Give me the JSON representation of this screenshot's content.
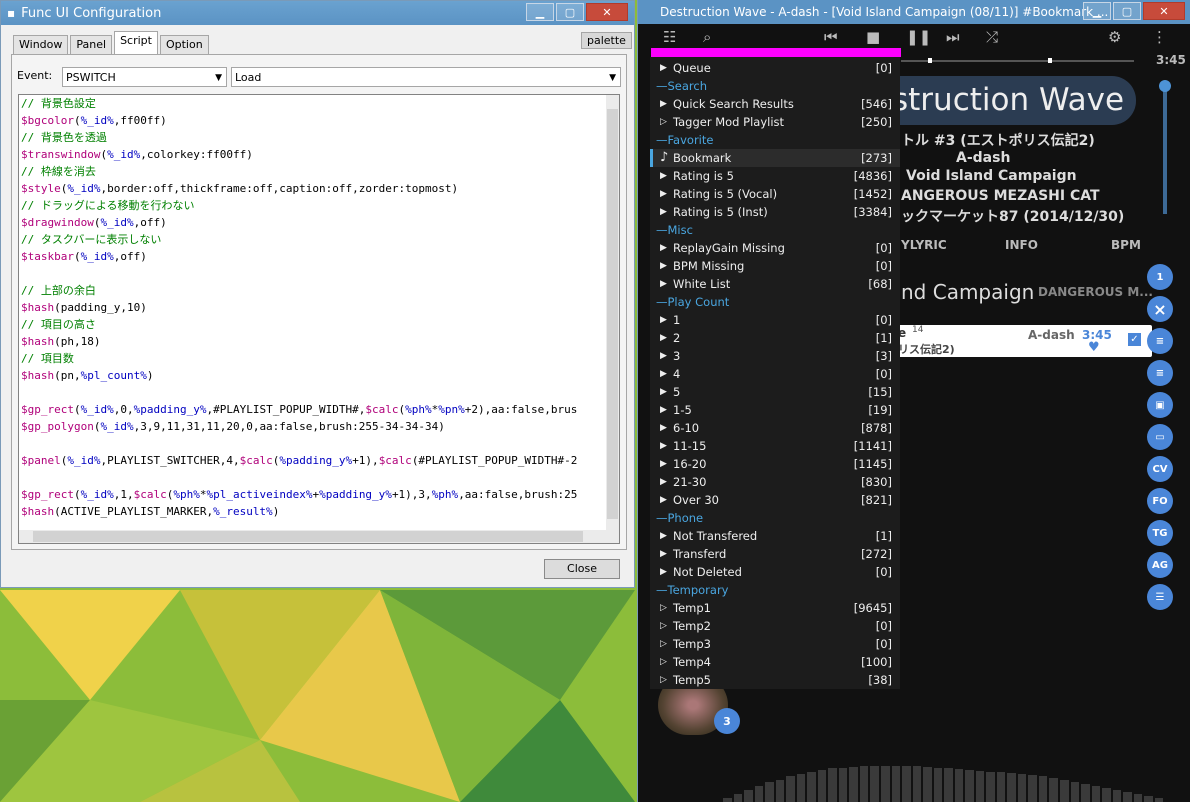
{
  "left_window": {
    "title": "Func UI Configuration",
    "tabs": [
      "Window",
      "Panel",
      "Script",
      "Option"
    ],
    "active_tab": "Script",
    "palette_label": "palette",
    "event_label": "Event:",
    "event_select": "PSWITCH",
    "action_select": "Load",
    "code_lines": [
      "// 背景色設定",
      "$bgcolor(%_id%,ff00ff)",
      "// 背景色を透過",
      "$transwindow(%_id%,colorkey:ff00ff)",
      "// 枠線を消去",
      "$style(%_id%,border:off,thickframe:off,caption:off,zorder:topmost)",
      "// ドラッグによる移動を行わない",
      "$dragwindow(%_id%,off)",
      "// タスクバーに表示しない",
      "$taskbar(%_id%,off)",
      "",
      "// 上部の余白",
      "$hash(padding_y,10)",
      "// 項目の高さ",
      "$hash(ph,18)",
      "// 項目数",
      "$hash(pn,%pl_count%)",
      "",
      "$gp_rect(%_id%,0,%padding_y%,#PLAYLIST_POPUP_WIDTH#,$calc(%ph%*%pn%+2),aa:false,brus",
      "$gp_polygon(%_id%,3,9,11,31,11,20,0,aa:false,brush:255-34-34-34)",
      "",
      "$panel(%_id%,PLAYLIST_SWITCHER,4,$calc(%padding_y%+1),$calc(#PLAYLIST_POPUP_WIDTH#-2",
      "",
      "$gp_rect(%_id%,1,$calc(%ph%*%pl_activeindex%+%padding_y%+1),3,%ph%,aa:false,brush:25",
      "$hash(ACTIVE_PLAYLIST_MARKER,%_result%)"
    ],
    "close_label": "Close"
  },
  "right_window": {
    "title": "Destruction Wave - A-dash - [Void Island Campaign (08/11)]  #Bookmark ...",
    "time": "3:45",
    "track_title": "struction Wave",
    "info_lines": [
      "トル #3 (エストポリス伝記2)",
      "A-dash",
      "Void Island Campaign",
      "ANGEROUS MEZASHI CAT",
      "ックマーケット87 (2014/12/30)"
    ],
    "tab_labels": [
      "YLYRIC",
      "INFO",
      "BPM"
    ],
    "album_line": "nd Campaign",
    "artist_line": "DANGEROUS M...",
    "track_row": {
      "title": "e",
      "num": "14",
      "sub": "リス伝記2)",
      "artist": "A-dash",
      "duration": "3:45"
    },
    "side_buttons": [
      "1",
      "×",
      "",
      "",
      "",
      "",
      "CV",
      "FO",
      "TG",
      "AG",
      ""
    ],
    "disc_badge": "3"
  },
  "popup": {
    "items": [
      {
        "type": "item",
        "icon": "▶",
        "label": "Queue",
        "count": "[0]"
      },
      {
        "type": "section",
        "label": "—Search"
      },
      {
        "type": "item",
        "icon": "▶",
        "label": "Quick Search Results",
        "count": "[546]"
      },
      {
        "type": "item",
        "icon": "▷",
        "label": "Tagger Mod Playlist",
        "count": "[250]"
      },
      {
        "type": "section",
        "label": "—Favorite"
      },
      {
        "type": "item",
        "icon": "♪",
        "label": "Bookmark",
        "count": "[273]",
        "active": true
      },
      {
        "type": "item",
        "icon": "▶",
        "label": "Rating is 5",
        "count": "[4836]"
      },
      {
        "type": "item",
        "icon": "▶",
        "label": "Rating is 5 (Vocal)",
        "count": "[1452]"
      },
      {
        "type": "item",
        "icon": "▶",
        "label": "Rating is 5 (Inst)",
        "count": "[3384]"
      },
      {
        "type": "section",
        "label": "—Misc"
      },
      {
        "type": "item",
        "icon": "▶",
        "label": "ReplayGain Missing",
        "count": "[0]"
      },
      {
        "type": "item",
        "icon": "▶",
        "label": "BPM Missing",
        "count": "[0]"
      },
      {
        "type": "item",
        "icon": "▶",
        "label": "White List",
        "count": "[68]"
      },
      {
        "type": "section",
        "label": "—Play Count"
      },
      {
        "type": "item",
        "icon": "▶",
        "label": "1",
        "count": "[0]"
      },
      {
        "type": "item",
        "icon": "▶",
        "label": "2",
        "count": "[1]"
      },
      {
        "type": "item",
        "icon": "▶",
        "label": "3",
        "count": "[3]"
      },
      {
        "type": "item",
        "icon": "▶",
        "label": "4",
        "count": "[0]"
      },
      {
        "type": "item",
        "icon": "▶",
        "label": "5",
        "count": "[15]"
      },
      {
        "type": "item",
        "icon": "▶",
        "label": "1-5",
        "count": "[19]"
      },
      {
        "type": "item",
        "icon": "▶",
        "label": "6-10",
        "count": "[878]"
      },
      {
        "type": "item",
        "icon": "▶",
        "label": "11-15",
        "count": "[1141]"
      },
      {
        "type": "item",
        "icon": "▶",
        "label": "16-20",
        "count": "[1145]"
      },
      {
        "type": "item",
        "icon": "▶",
        "label": "21-30",
        "count": "[830]"
      },
      {
        "type": "item",
        "icon": "▶",
        "label": "Over 30",
        "count": "[821]"
      },
      {
        "type": "section",
        "label": "—Phone"
      },
      {
        "type": "item",
        "icon": "▶",
        "label": "Not Transfered",
        "count": "[1]"
      },
      {
        "type": "item",
        "icon": "▶",
        "label": "Transferd",
        "count": "[272]"
      },
      {
        "type": "item",
        "icon": "▶",
        "label": "Not Deleted",
        "count": "[0]"
      },
      {
        "type": "section",
        "label": "—Temporary"
      },
      {
        "type": "item",
        "icon": "▷",
        "label": "Temp1",
        "count": "[9645]"
      },
      {
        "type": "item",
        "icon": "▷",
        "label": "Temp2",
        "count": "[0]"
      },
      {
        "type": "item",
        "icon": "▷",
        "label": "Temp3",
        "count": "[0]"
      },
      {
        "type": "item",
        "icon": "▷",
        "label": "Temp4",
        "count": "[100]"
      },
      {
        "type": "item",
        "icon": "▷",
        "label": "Temp5",
        "count": "[38]"
      }
    ]
  },
  "colors": {
    "accent": "#4aa6e0",
    "magenta": "#ff00ff",
    "comment": "#008000",
    "func": "#b0007a",
    "var": "#0000c0"
  }
}
